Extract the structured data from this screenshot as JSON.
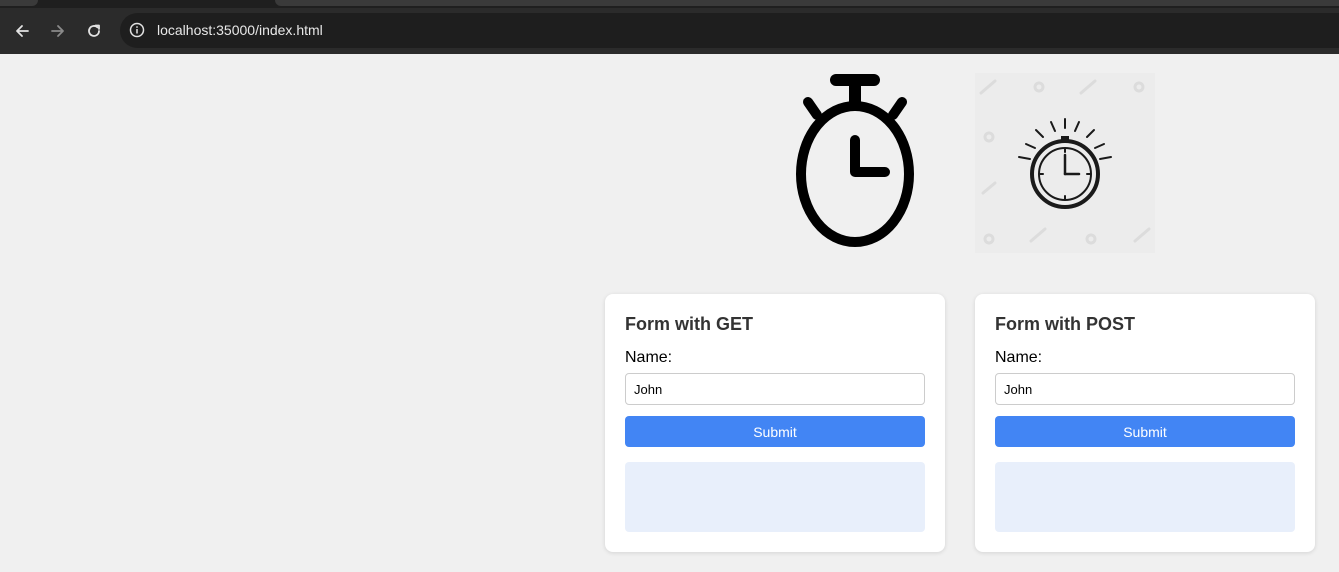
{
  "browser": {
    "url": "localhost:35000/index.html",
    "icons": [
      "back-arrow-icon",
      "forward-arrow-icon",
      "reload-icon",
      "info-icon"
    ]
  },
  "images": {
    "timer1": "stopwatch-icon",
    "timer2": "stopwatch-icon"
  },
  "forms": {
    "get": {
      "title": "Form with GET",
      "name_label": "Name:",
      "name_value": "John",
      "submit_label": "Submit"
    },
    "post": {
      "title": "Form with POST",
      "name_label": "Name:",
      "name_value": "John",
      "submit_label": "Submit"
    }
  },
  "colors": {
    "submit": "#4285f4",
    "result_bg": "#e8effb",
    "page_bg": "#f0f0f0"
  }
}
